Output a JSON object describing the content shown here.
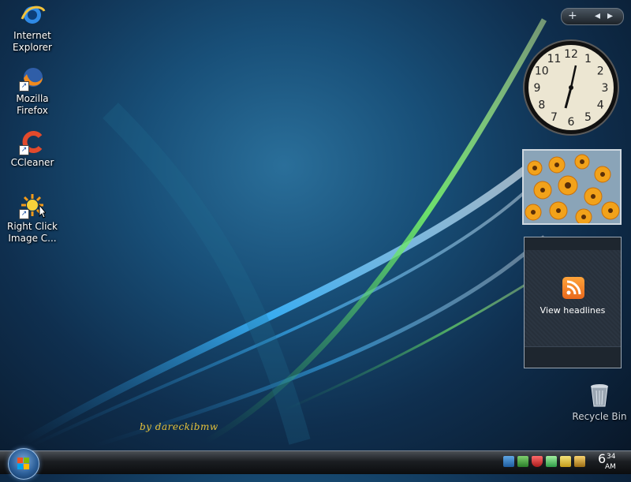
{
  "desktop": {
    "icons": [
      {
        "label": "Internet Explorer",
        "line1": "Internet",
        "line2": "Explorer",
        "icon": "internet-explorer-icon"
      },
      {
        "label": "Mozilla Firefox",
        "line1": "Mozilla Firefox",
        "line2": "",
        "icon": "firefox-icon"
      },
      {
        "label": "CCleaner",
        "line1": "CCleaner",
        "line2": "",
        "icon": "ccleaner-icon"
      },
      {
        "label": "Right Click Image C...",
        "line1": "Right Click",
        "line2": "Image C...",
        "icon": "right-click-image-converter-icon"
      }
    ],
    "signature": "by dareckibmw",
    "recycle_bin": {
      "label": "Recycle Bin",
      "icon": "recycle-bin-icon"
    }
  },
  "sidebar": {
    "controls": {
      "add": "+",
      "prev": "◂",
      "next": "▸"
    },
    "clock": {
      "numbers": [
        "12",
        "1",
        "2",
        "3",
        "4",
        "5",
        "6",
        "7",
        "8",
        "9",
        "10",
        "11"
      ],
      "time": "6:34"
    },
    "feed": {
      "label": "View headlines",
      "icon": "rss-icon"
    }
  },
  "taskbar": {
    "start_icon": "windows-start-orb-icon",
    "tray_icons": [
      "network-icon",
      "display-icon",
      "security-shield-icon",
      "update-icon",
      "s-app-icon",
      "wand-icon"
    ],
    "clock": {
      "hour": "6",
      "minutes": "34",
      "ampm": "AM"
    }
  },
  "colors": {
    "signature": "#e6c23a",
    "accent_green": "#6fe06a",
    "accent_blue": "#4fc0ff"
  }
}
